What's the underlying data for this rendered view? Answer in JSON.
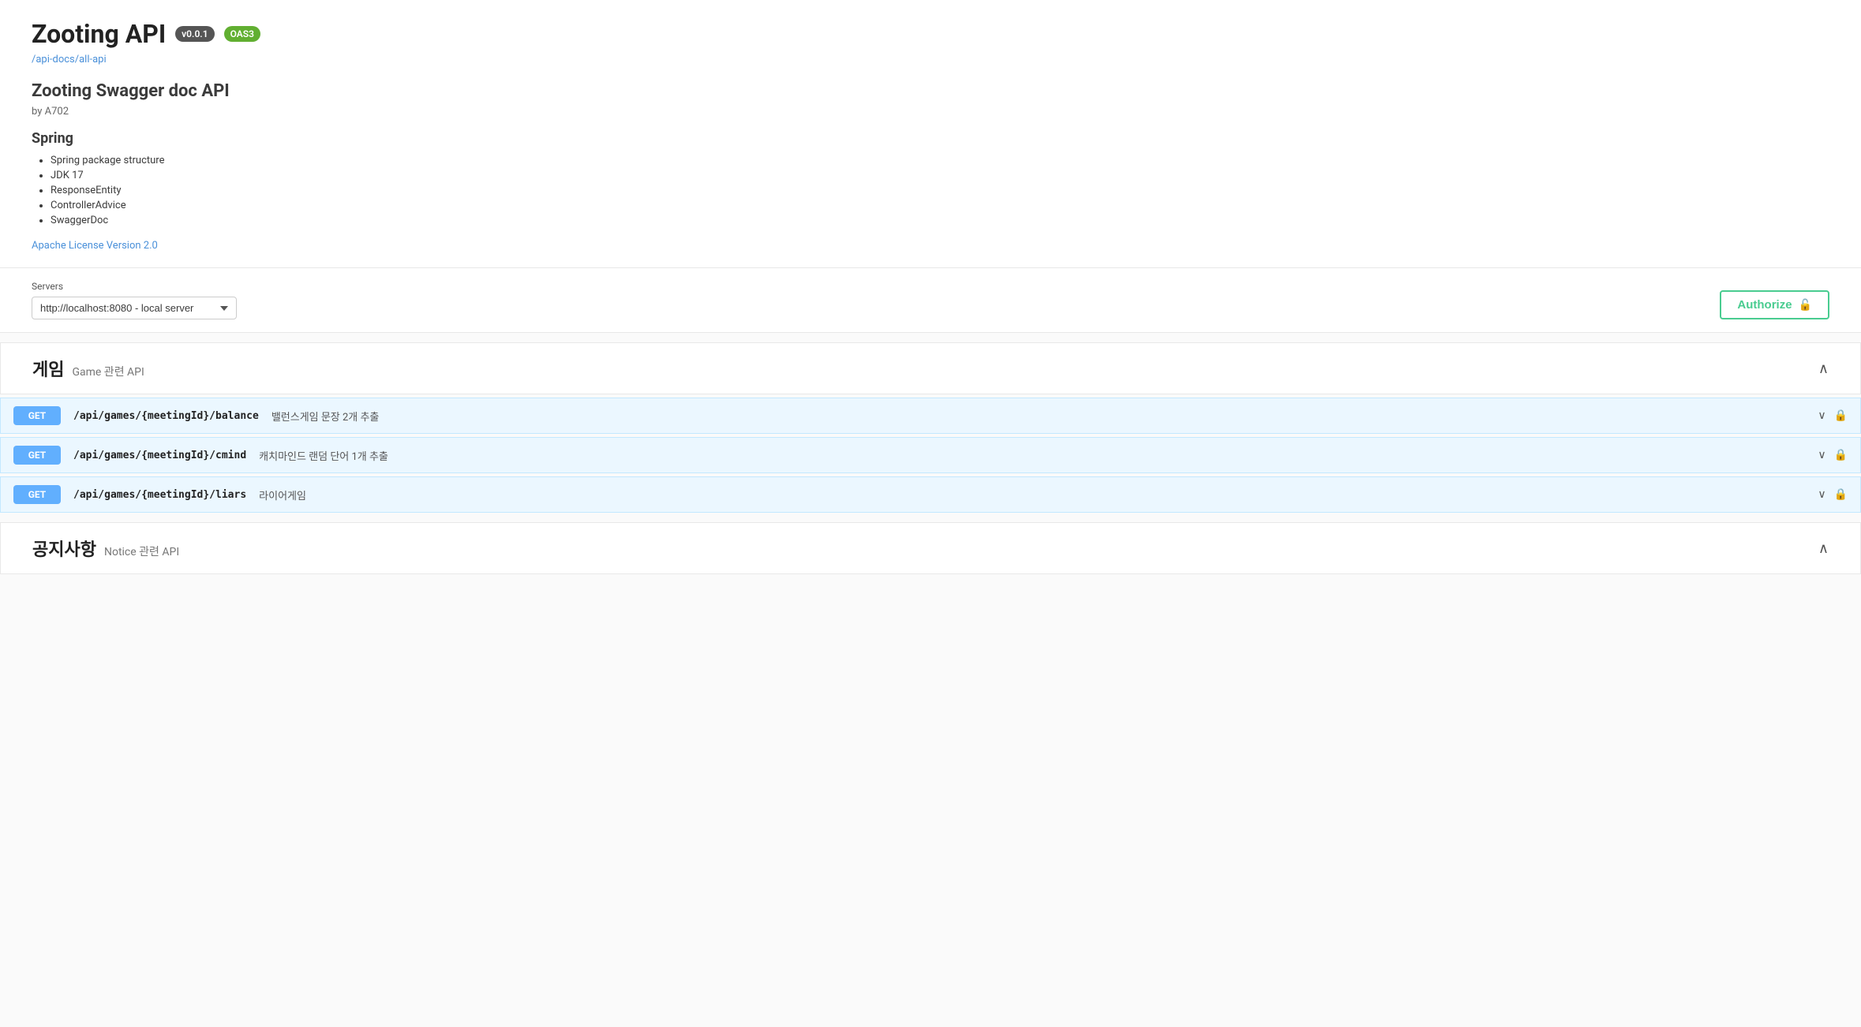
{
  "header": {
    "title": "Zooting API",
    "version_badge": "v0.0.1",
    "oas3_badge": "OAS3",
    "api_url": "/api-docs/all-api",
    "description_title": "Zooting Swagger doc API",
    "by": "by A702",
    "spring_title": "Spring",
    "spring_items": [
      "Spring package structure",
      "JDK 17",
      "ResponseEntity",
      "ControllerAdvice",
      "SwaggerDoc"
    ],
    "license_text": "Apache License Version 2.0"
  },
  "servers": {
    "label": "Servers",
    "options": [
      "http://localhost:8080 - local server"
    ],
    "selected": "http://localhost:8080 - local server"
  },
  "authorize": {
    "label": "Authorize",
    "lock_icon": "🔓"
  },
  "sections": [
    {
      "id": "game",
      "title_kr": "게임",
      "title_en": "Game 관련 API",
      "expanded": true,
      "endpoints": [
        {
          "method": "GET",
          "path": "/api/games/{meetingId}/balance",
          "description": "밸런스게임 문장 2개 추출"
        },
        {
          "method": "GET",
          "path": "/api/games/{meetingId}/cmind",
          "description": "캐치마인드 랜덤 단어 1개 추출"
        },
        {
          "method": "GET",
          "path": "/api/games/{meetingId}/liars",
          "description": "라이어게임"
        }
      ]
    },
    {
      "id": "notice",
      "title_kr": "공지사항",
      "title_en": "Notice 관련 API",
      "expanded": true,
      "endpoints": []
    }
  ]
}
